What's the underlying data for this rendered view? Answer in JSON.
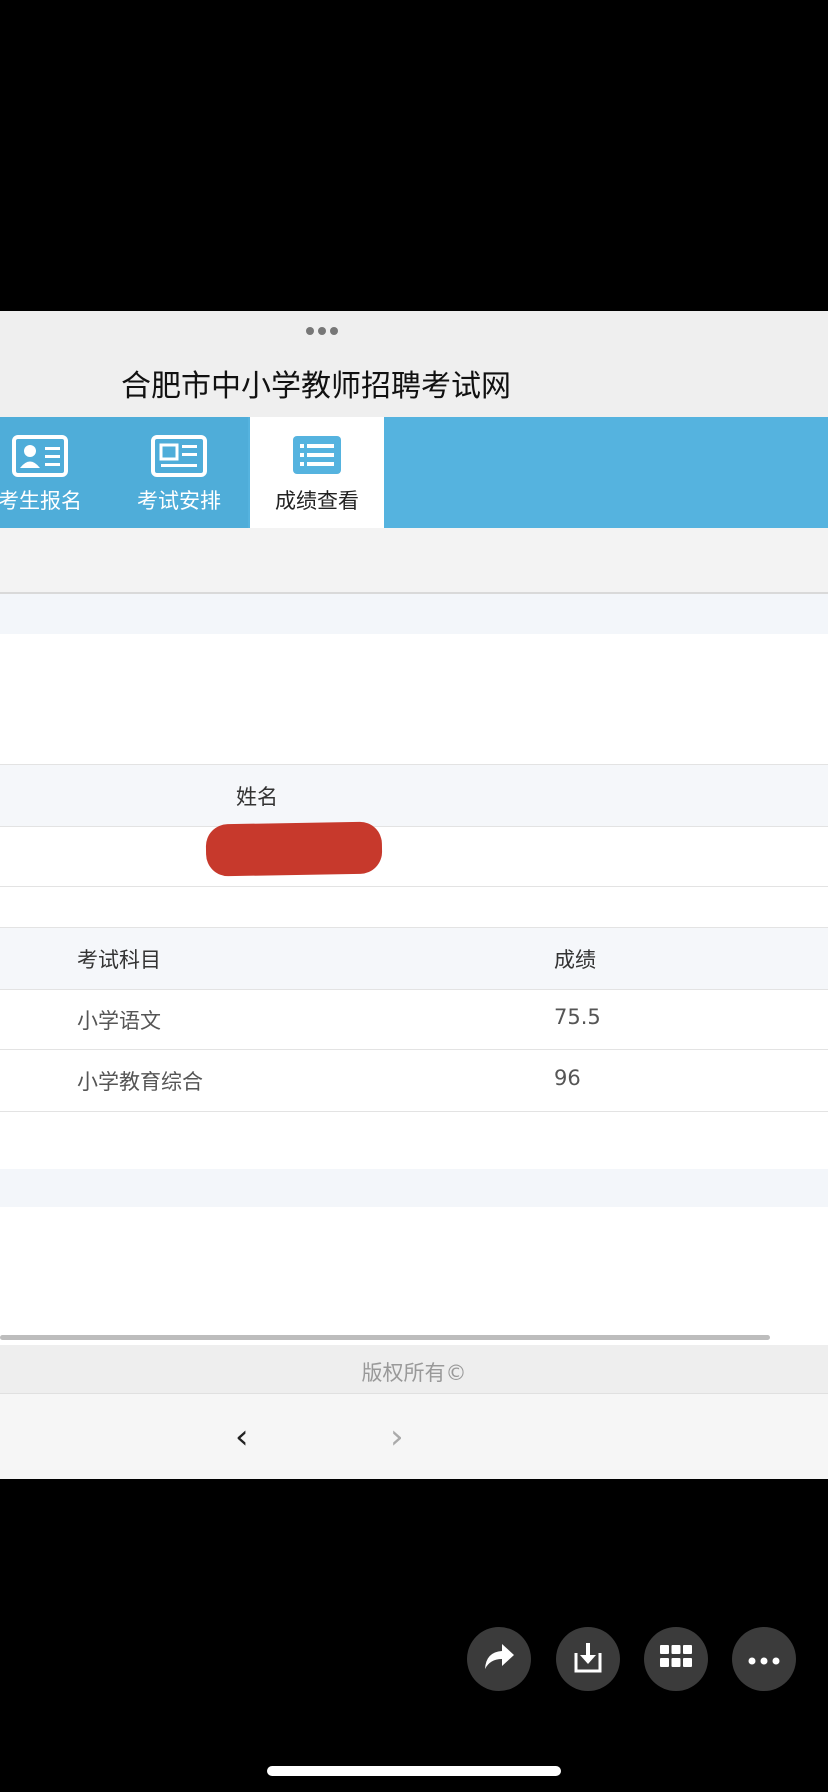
{
  "header": {
    "title": "合肥市中小学教师招聘考试网"
  },
  "nav": {
    "tabs": [
      {
        "label": "考生报名",
        "icon": "id-card-icon"
      },
      {
        "label": "考试安排",
        "icon": "newspaper-icon"
      },
      {
        "label": "成绩查看",
        "icon": "list-icon"
      }
    ]
  },
  "info": {
    "name_header": "姓名",
    "name_value": ""
  },
  "scores": {
    "headers": {
      "subject": "考试科目",
      "score": "成绩"
    },
    "rows": [
      {
        "subject": "小学语文",
        "score": "75.5"
      },
      {
        "subject": "小学教育综合",
        "score": "96"
      }
    ]
  },
  "footer": {
    "copyright": "版权所有©"
  },
  "browser": {
    "back": "‹",
    "forward": "›"
  },
  "overlay_buttons": [
    "share-icon",
    "download-icon",
    "grid-icon",
    "more-icon"
  ],
  "colors": {
    "nav_blue": "#55b3df",
    "redaction": "#c7392c"
  }
}
